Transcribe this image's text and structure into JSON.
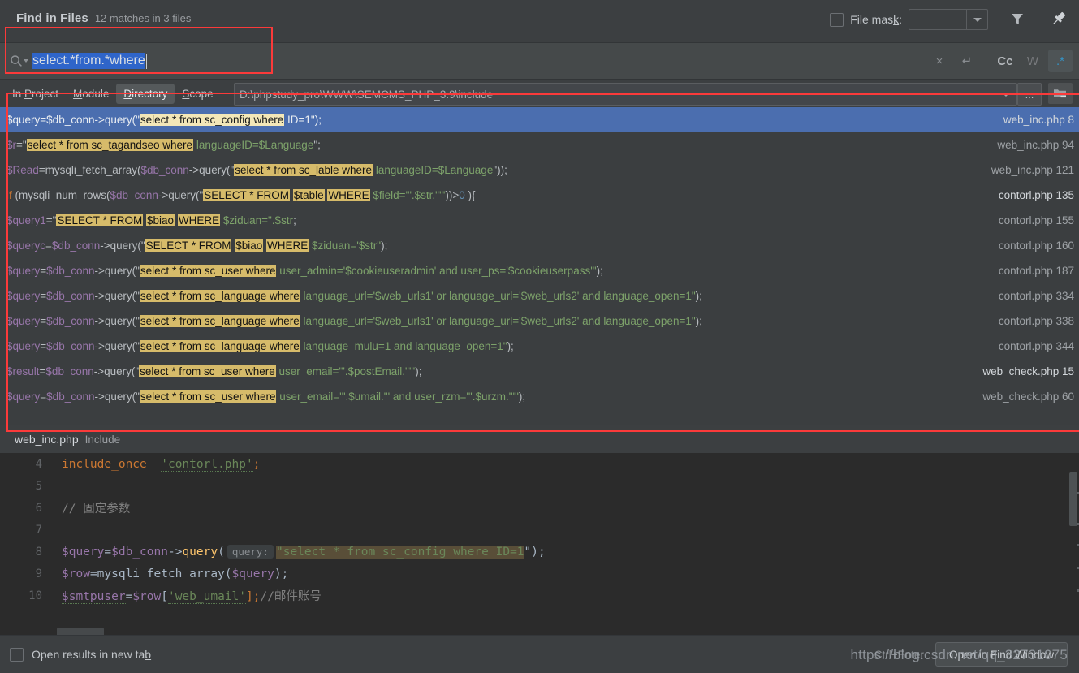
{
  "header": {
    "title": "Find in Files",
    "subtitle": "12 matches in 3 files",
    "file_mask_label": "File mask:",
    "file_mask_value": "",
    "filter_icon": "filter-icon",
    "pin_icon": "pin-icon"
  },
  "search": {
    "query": "select.*from.*where",
    "placeholder": "",
    "magnifier_icon": "search-icon",
    "clear_label": "×",
    "newline_label": "↵",
    "match_case_label": "Cc",
    "words_label": "W",
    "regex_label": ".*",
    "regex_active": true
  },
  "scope": {
    "tabs": [
      {
        "label": "In Project",
        "accel": "P",
        "active": false
      },
      {
        "label": "Module",
        "accel": "M",
        "active": false
      },
      {
        "label": "Directory",
        "accel": "D",
        "active": true
      },
      {
        "label": "Scope",
        "accel": "S",
        "active": false
      }
    ],
    "directory": "D:\\phpstudy_pro\\WWW\\SEMCMS_PHP_3.9\\include",
    "browse_label": "...",
    "recent_icon": "recent-directories-icon"
  },
  "results": [
    {
      "file": "web_inc.php",
      "line": "8",
      "selected": true,
      "strong": true,
      "parts": [
        {
          "t": "var",
          "s": "$query"
        },
        {
          "t": "pun",
          "s": "="
        },
        {
          "t": "var",
          "s": "$db_conn"
        },
        {
          "t": "pun",
          "s": "->query(\""
        },
        {
          "t": "hl",
          "s": "select * from sc_config where"
        },
        {
          "t": "str",
          "s": " ID=1"
        },
        {
          "t": "pun",
          "s": "\");"
        }
      ]
    },
    {
      "file": "web_inc.php",
      "line": "94",
      "selected": false,
      "strong": false,
      "parts": [
        {
          "t": "var",
          "s": "$r"
        },
        {
          "t": "pun",
          "s": "=\""
        },
        {
          "t": "hl",
          "s": "select * from sc_tagandseo where"
        },
        {
          "t": "str",
          "s": " languageID=$Language"
        },
        {
          "t": "pun",
          "s": "\";"
        }
      ]
    },
    {
      "file": "web_inc.php",
      "line": "121",
      "selected": false,
      "strong": false,
      "parts": [
        {
          "t": "var",
          "s": "$Read"
        },
        {
          "t": "pun",
          "s": "=mysqli_fetch_array("
        },
        {
          "t": "var",
          "s": "$db_conn"
        },
        {
          "t": "pun",
          "s": "->query(\""
        },
        {
          "t": "hl",
          "s": "select * from sc_lable where"
        },
        {
          "t": "str",
          "s": " languageID=$Language"
        },
        {
          "t": "pun",
          "s": "\"));"
        }
      ]
    },
    {
      "file": "contorl.php",
      "line": "135",
      "selected": false,
      "strong": true,
      "parts": [
        {
          "t": "kw",
          "s": "if"
        },
        {
          "t": "pun",
          "s": " (mysqli_num_rows("
        },
        {
          "t": "var",
          "s": "$db_conn"
        },
        {
          "t": "pun",
          "s": "->query(\""
        },
        {
          "t": "hl",
          "s": "SELECT * FROM"
        },
        {
          "t": "pun",
          "s": " "
        },
        {
          "t": "hl",
          "s": "$table"
        },
        {
          "t": "pun",
          "s": " "
        },
        {
          "t": "hl",
          "s": "WHERE"
        },
        {
          "t": "str",
          "s": " $field='\".$str.\"'\""
        },
        {
          "t": "pun",
          "s": "))>"
        },
        {
          "t": "num",
          "s": "0"
        },
        {
          "t": "pun",
          "s": " ){"
        }
      ]
    },
    {
      "file": "contorl.php",
      "line": "155",
      "selected": false,
      "strong": false,
      "parts": [
        {
          "t": "var",
          "s": "$query1"
        },
        {
          "t": "pun",
          "s": "=\""
        },
        {
          "t": "hl",
          "s": "SELECT * FROM"
        },
        {
          "t": "pun",
          "s": " "
        },
        {
          "t": "hl",
          "s": "$biao"
        },
        {
          "t": "pun",
          "s": " "
        },
        {
          "t": "hl",
          "s": "WHERE"
        },
        {
          "t": "str",
          "s": " $ziduan=\".$str"
        },
        {
          "t": "pun",
          "s": ";"
        }
      ]
    },
    {
      "file": "contorl.php",
      "line": "160",
      "selected": false,
      "strong": false,
      "parts": [
        {
          "t": "var",
          "s": "$queryc"
        },
        {
          "t": "pun",
          "s": "="
        },
        {
          "t": "var",
          "s": "$db_conn"
        },
        {
          "t": "pun",
          "s": "->query(\""
        },
        {
          "t": "hl",
          "s": "SELECT * FROM"
        },
        {
          "t": "pun",
          "s": " "
        },
        {
          "t": "hl",
          "s": "$biao"
        },
        {
          "t": "pun",
          "s": " "
        },
        {
          "t": "hl",
          "s": "WHERE"
        },
        {
          "t": "str",
          "s": " $ziduan='$str\""
        },
        {
          "t": "pun",
          "s": ");"
        }
      ]
    },
    {
      "file": "contorl.php",
      "line": "187",
      "selected": false,
      "strong": false,
      "parts": [
        {
          "t": "var",
          "s": "$query"
        },
        {
          "t": "pun",
          "s": "="
        },
        {
          "t": "var",
          "s": "$db_conn"
        },
        {
          "t": "pun",
          "s": "->query(\""
        },
        {
          "t": "hl",
          "s": "select * from sc_user where"
        },
        {
          "t": "str",
          "s": " user_admin='$cookieuseradmin' and user_ps='$cookieuserpass'\""
        },
        {
          "t": "pun",
          "s": ");"
        }
      ]
    },
    {
      "file": "contorl.php",
      "line": "334",
      "selected": false,
      "strong": false,
      "parts": [
        {
          "t": "var",
          "s": "$query"
        },
        {
          "t": "pun",
          "s": "="
        },
        {
          "t": "var",
          "s": "$db_conn"
        },
        {
          "t": "pun",
          "s": "->query(\""
        },
        {
          "t": "hl",
          "s": "select * from sc_language where"
        },
        {
          "t": "str",
          "s": " language_url='$web_urls1' or  language_url='$web_urls2' and  language_open=1\""
        },
        {
          "t": "pun",
          "s": ");"
        }
      ]
    },
    {
      "file": "contorl.php",
      "line": "338",
      "selected": false,
      "strong": false,
      "parts": [
        {
          "t": "var",
          "s": "$query"
        },
        {
          "t": "pun",
          "s": "="
        },
        {
          "t": "var",
          "s": "$db_conn"
        },
        {
          "t": "pun",
          "s": "->query(\""
        },
        {
          "t": "hl",
          "s": "select * from sc_language where"
        },
        {
          "t": "str",
          "s": " language_url='$web_urls1' or  language_url='$web_urls2' and  language_open=1\""
        },
        {
          "t": "pun",
          "s": ");"
        }
      ]
    },
    {
      "file": "contorl.php",
      "line": "344",
      "selected": false,
      "strong": false,
      "parts": [
        {
          "t": "var",
          "s": "$query"
        },
        {
          "t": "pun",
          "s": "="
        },
        {
          "t": "var",
          "s": "$db_conn"
        },
        {
          "t": "pun",
          "s": "->query(\""
        },
        {
          "t": "hl",
          "s": "select * from sc_language where"
        },
        {
          "t": "str",
          "s": " language_mulu=1 and  language_open=1\""
        },
        {
          "t": "pun",
          "s": ");"
        }
      ]
    },
    {
      "file": "web_check.php",
      "line": "15",
      "selected": false,
      "strong": true,
      "parts": [
        {
          "t": "var",
          "s": "$result"
        },
        {
          "t": "pun",
          "s": "="
        },
        {
          "t": "var",
          "s": "$db_conn"
        },
        {
          "t": "pun",
          "s": "->query(\""
        },
        {
          "t": "hl",
          "s": "select * from sc_user where"
        },
        {
          "t": "str",
          "s": " user_email='\".$postEmail.\"'\""
        },
        {
          "t": "pun",
          "s": ");"
        }
      ]
    },
    {
      "file": "web_check.php",
      "line": "60",
      "selected": false,
      "strong": false,
      "parts": [
        {
          "t": "var",
          "s": "$query"
        },
        {
          "t": "pun",
          "s": "="
        },
        {
          "t": "var",
          "s": "$db_conn"
        },
        {
          "t": "pun",
          "s": "->query(\""
        },
        {
          "t": "hl",
          "s": "select * from sc_user where"
        },
        {
          "t": "str",
          "s": " user_email='\".$umail.\"' and user_rzm='\".$urzm.\"'\""
        },
        {
          "t": "pun",
          "s": ");"
        }
      ]
    }
  ],
  "preview": {
    "file": "web_inc.php",
    "directory": "Include",
    "hint_label": "query:",
    "lines": [
      {
        "num": "4"
      },
      {
        "num": "5"
      },
      {
        "num": "6"
      },
      {
        "num": "7"
      },
      {
        "num": "8"
      },
      {
        "num": "9"
      },
      {
        "num": "10"
      }
    ],
    "code": {
      "l4_kw": "include_once",
      "l4_str": "'contorl.php'",
      "l4_end": ";",
      "l6_comment": "// 固定参数",
      "l8_a": "$query",
      "l8_b": "=",
      "l8_c": "$db_conn",
      "l8_d": "->",
      "l8_e": "query",
      "l8_f": "(",
      "l8_match": "\"select * from sc_config where ID=1",
      "l8_tail": "\");",
      "l9": "$row=mysqli_fetch_array($query);",
      "l9_a": "$row",
      "l9_b": "=mysqli_fetch_array(",
      "l9_c": "$query",
      "l9_d": ");",
      "l10_a": "$smtpuser",
      "l10_b": "=",
      "l10_c": "$row",
      "l10_d": "[",
      "l10_e": "'web_umail'",
      "l10_f": "];",
      "l10_g": "//邮件账号"
    }
  },
  "footer": {
    "open_new_tab_label": "Open results in new tab",
    "open_new_tab_accel": "b",
    "shortcut": "Ctrl+Enter",
    "primary_button": "Open in Find Window"
  },
  "watermark": "https://blog.csdn.net/qq_32731075",
  "colors": {
    "selection_blue": "#4b6eaf",
    "highlight_gold": "#d6bb6a",
    "accent_blue": "#3592c4",
    "annotation_red": "#fb3a3a",
    "panel_bg": "#3c3f41",
    "editor_bg": "#2b2b2b"
  }
}
